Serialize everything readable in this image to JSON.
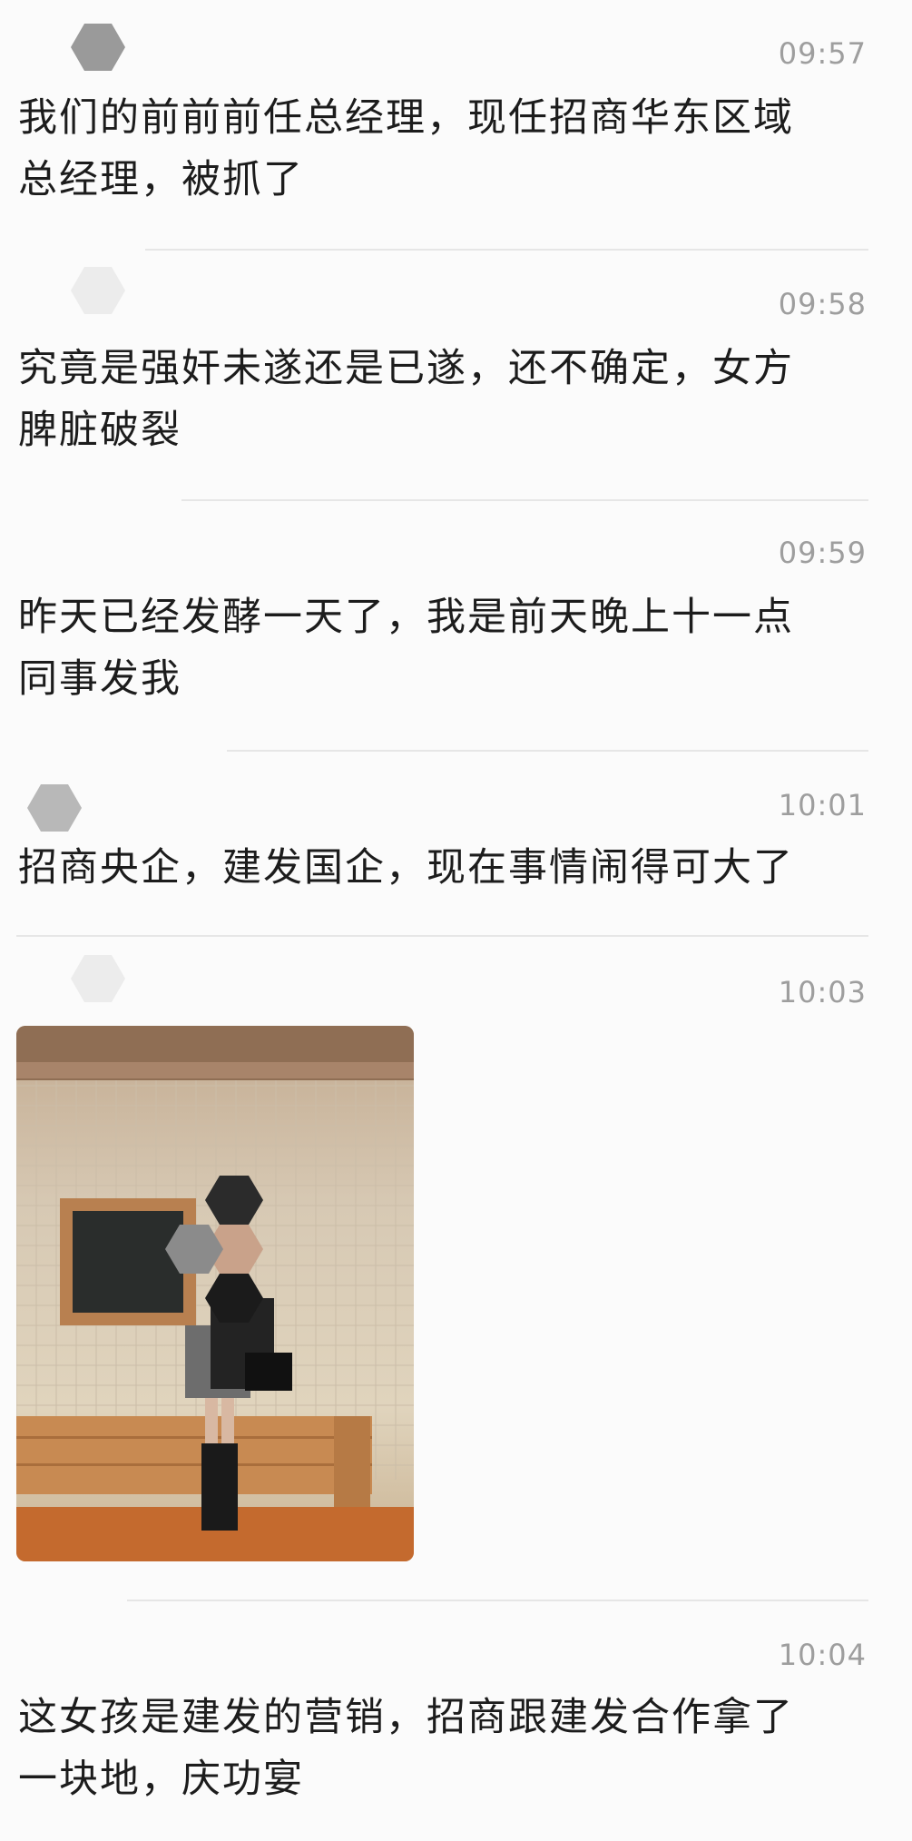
{
  "messages": [
    {
      "time": "09:57",
      "text": "我们的前前前任总经理，现任招商华东区域\n总经理，被抓了"
    },
    {
      "time": "09:58",
      "text": "究竟是强奸未遂还是已遂，还不确定，女方\n脾脏破裂"
    },
    {
      "time": "09:59",
      "text": "昨天已经发酵一天了，我是前天晚上十一点\n同事发我"
    },
    {
      "time": "10:01",
      "text": "招商央企，建发国企，现在事情闹得可大了"
    },
    {
      "time": "10:03",
      "text": ""
    },
    {
      "time": "10:04",
      "text": "这女孩是建发的营销，招商跟建发合作拿了\n一块地，庆功宴"
    }
  ],
  "photo": {
    "icon": "photo-icon"
  },
  "colors": {
    "background": "#fbfbfb",
    "text": "#1c1c1c",
    "time": "#9e9e9e",
    "divider": "#e6e6e6"
  }
}
